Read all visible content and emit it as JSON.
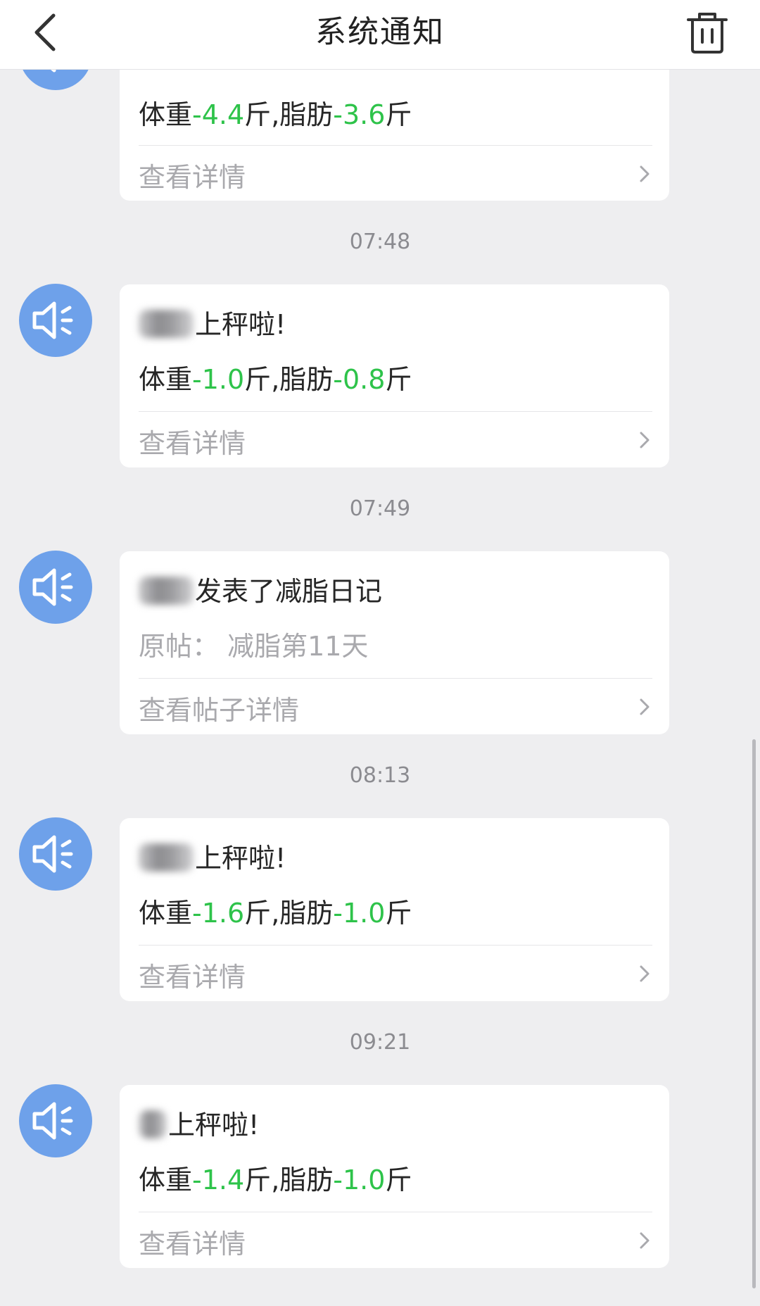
{
  "header": {
    "title": "系统通知",
    "back_icon": "chevron-left-icon",
    "trash_icon": "trash-icon"
  },
  "colors": {
    "accent_green": "#2ec34a",
    "avatar_blue": "#6ea1ea"
  },
  "notifications": [
    {
      "kind": "weigh-in",
      "weight_label": "体重",
      "weight_delta": "-4.4",
      "weight_unit": "斤",
      "fat_label": ",脂肪",
      "fat_delta": "-3.6",
      "fat_unit": "斤",
      "action": "查看详情"
    },
    {
      "time": "07:48",
      "kind": "weigh-in",
      "message": "上秤啦!",
      "weight_label": "体重",
      "weight_delta": "-1.0",
      "weight_unit": "斤",
      "fat_label": ",脂肪",
      "fat_delta": "-0.8",
      "fat_unit": "斤",
      "action": "查看详情"
    },
    {
      "time": "07:49",
      "kind": "post",
      "message": "发表了减脂日记",
      "original": "原帖： 减脂第11天",
      "action": "查看帖子详情"
    },
    {
      "time": "08:13",
      "kind": "weigh-in",
      "message": "上秤啦!",
      "weight_label": "体重",
      "weight_delta": "-1.6",
      "weight_unit": "斤",
      "fat_label": ",脂肪",
      "fat_delta": "-1.0",
      "fat_unit": "斤",
      "action": "查看详情"
    },
    {
      "time": "09:21",
      "kind": "weigh-in",
      "message": "上秤啦!",
      "weight_label": "体重",
      "weight_delta": "-1.4",
      "weight_unit": "斤",
      "fat_label": ",脂肪",
      "fat_delta": "-1.0",
      "fat_unit": "斤",
      "action": "查看详情"
    }
  ]
}
